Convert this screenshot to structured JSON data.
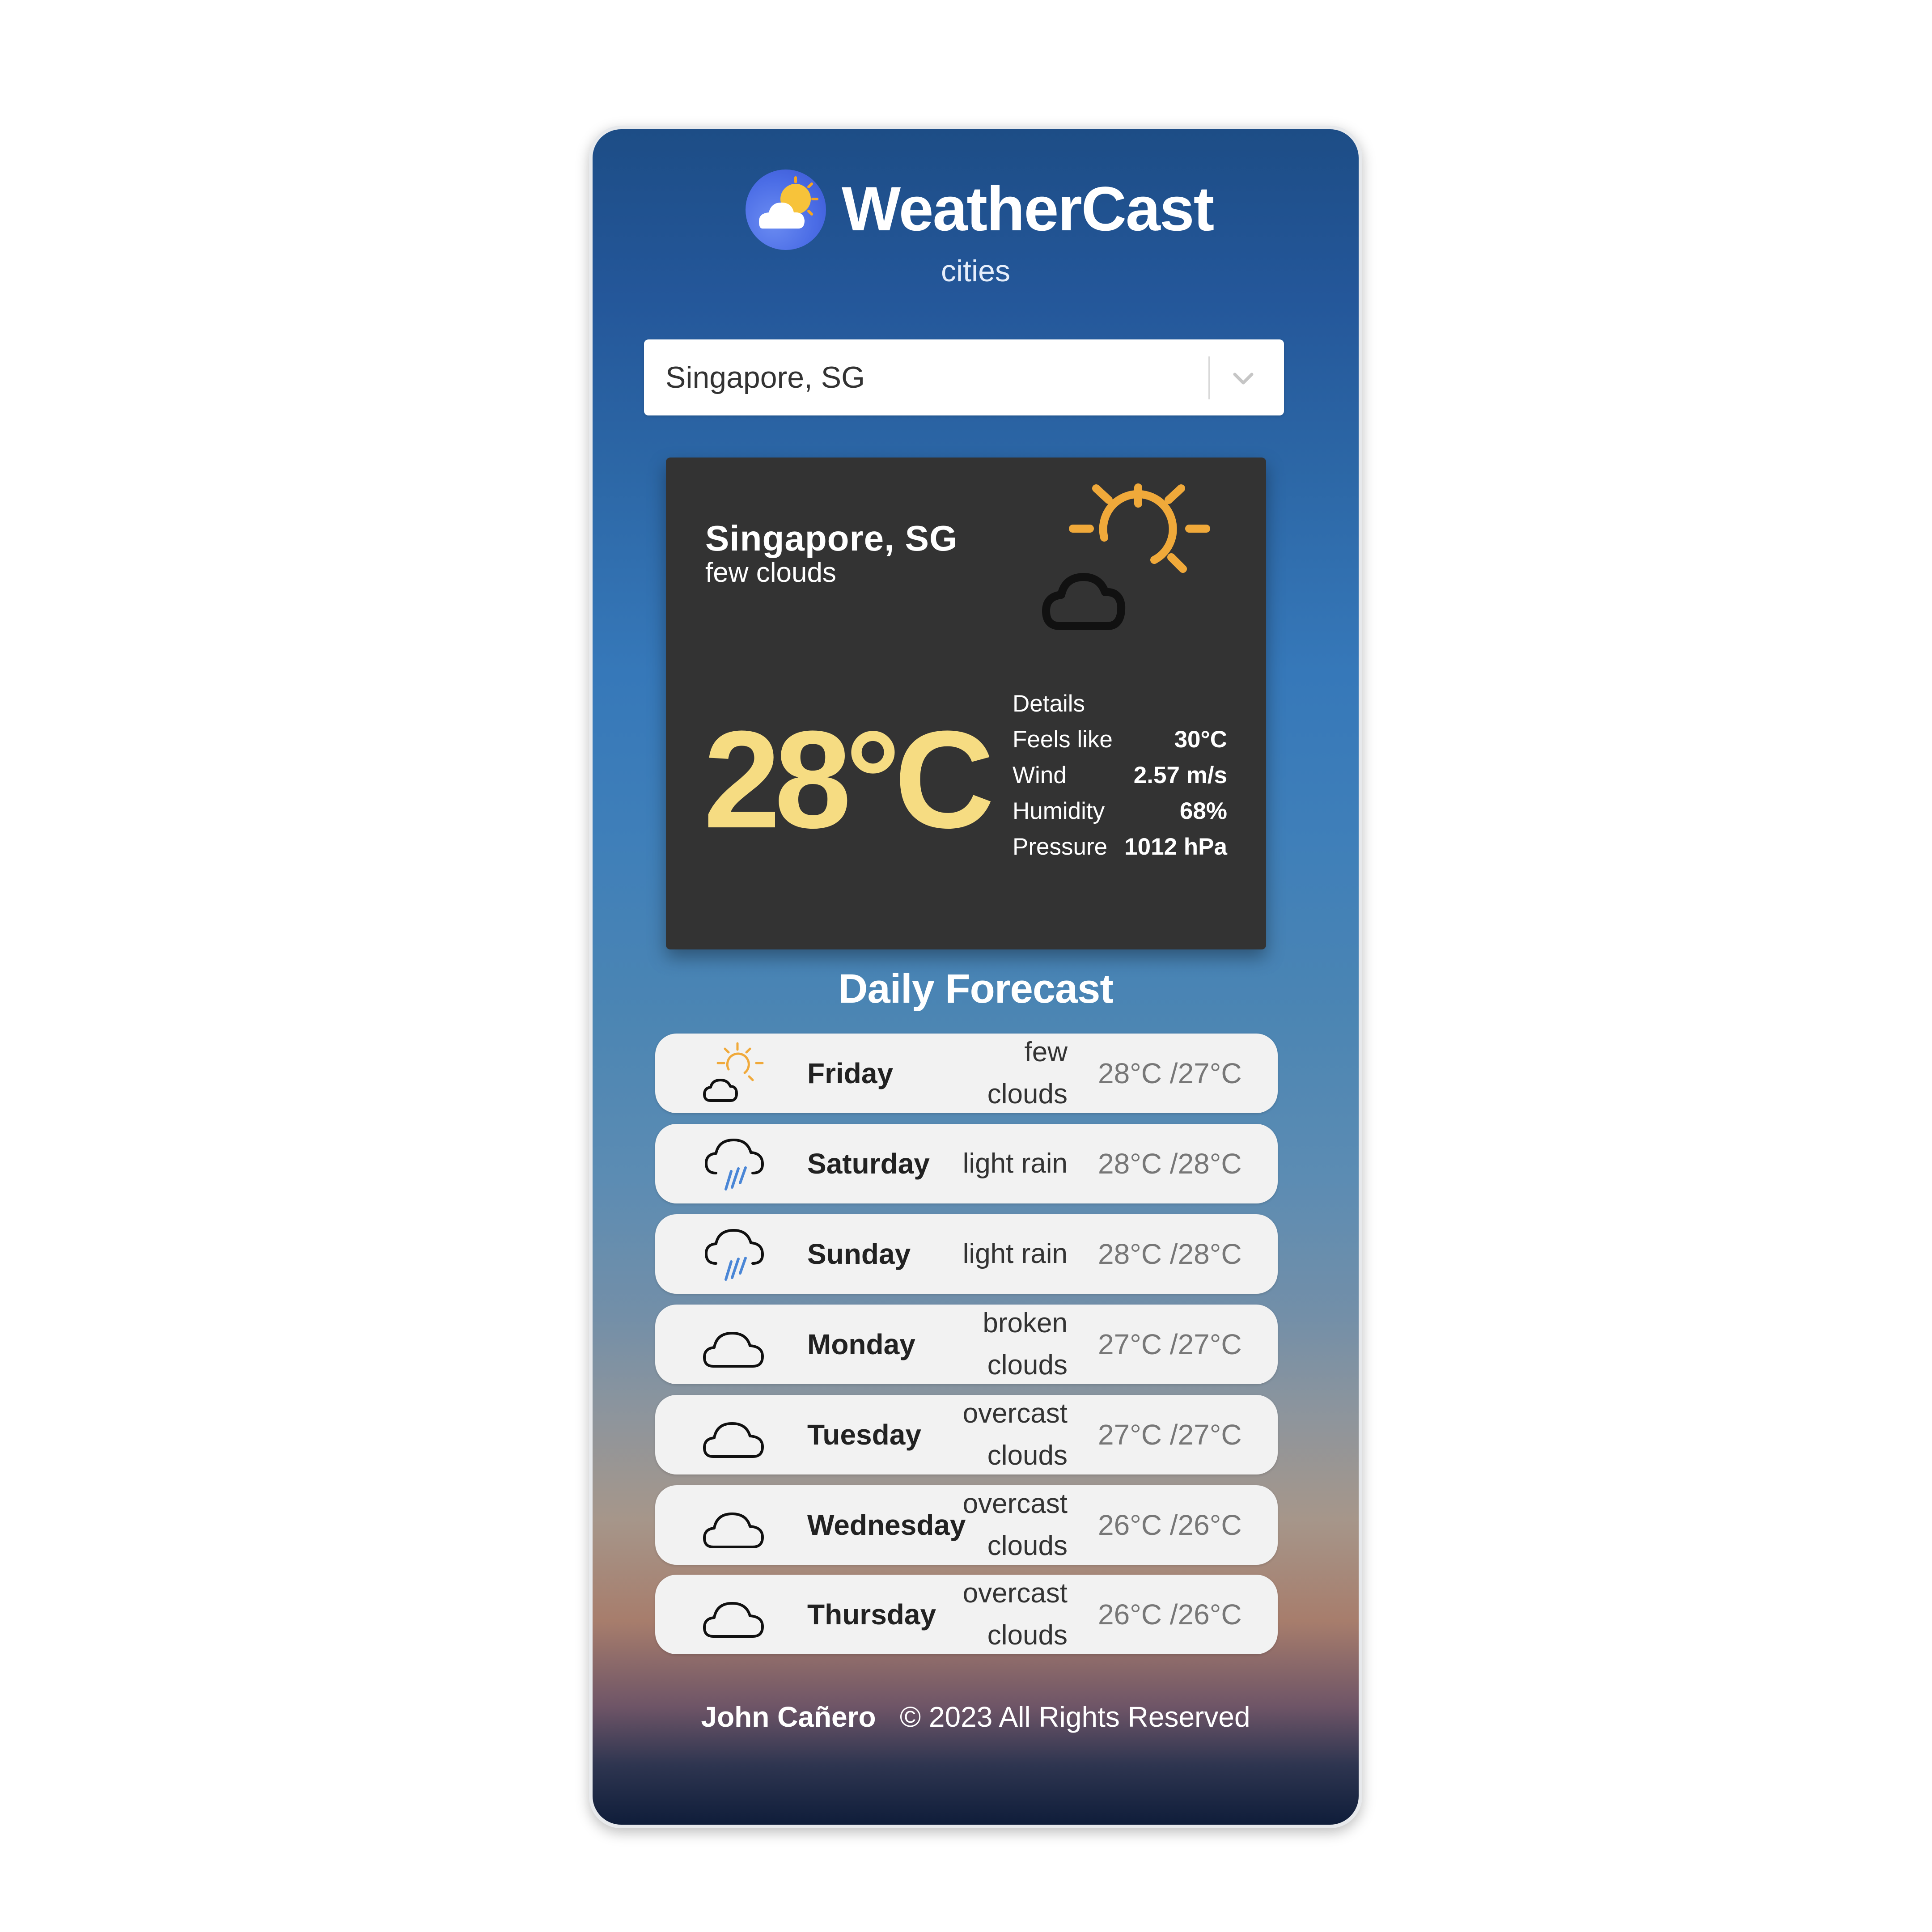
{
  "app": {
    "title": "WeatherCast",
    "subtitle": "cities",
    "logo_icon": "weather-logo-icon"
  },
  "search": {
    "selected": "Singapore, SG",
    "dropdown_icon": "chevron-down-icon"
  },
  "current": {
    "city": "Singapore, SG",
    "description": "few clouds",
    "icon": "sun-behind-cloud-icon",
    "temperature": "28°C",
    "details_label": "Details",
    "details": [
      {
        "label": "Feels like",
        "value": "30°C"
      },
      {
        "label": "Wind",
        "value": "2.57 m/s"
      },
      {
        "label": "Humidity",
        "value": "68%"
      },
      {
        "label": "Pressure",
        "value": "1012 hPa"
      }
    ]
  },
  "forecast": {
    "title": "Daily Forecast",
    "days": [
      {
        "day": "Friday",
        "description": "few clouds",
        "range": "28°C /27°C",
        "icon": "sun-cloud-icon"
      },
      {
        "day": "Saturday",
        "description": "light rain",
        "range": "28°C /28°C",
        "icon": "rain-cloud-icon"
      },
      {
        "day": "Sunday",
        "description": "light rain",
        "range": "28°C /28°C",
        "icon": "rain-cloud-icon"
      },
      {
        "day": "Monday",
        "description": "broken clouds",
        "range": "27°C /27°C",
        "icon": "cloud-icon"
      },
      {
        "day": "Tuesday",
        "description": "overcast clouds",
        "range": "27°C /27°C",
        "icon": "cloud-icon"
      },
      {
        "day": "Wednesday",
        "description": "overcast clouds",
        "range": "26°C /26°C",
        "icon": "cloud-icon"
      },
      {
        "day": "Thursday",
        "description": "overcast clouds",
        "range": "26°C /26°C",
        "icon": "cloud-icon"
      }
    ]
  },
  "footer": {
    "author": "John Cañero",
    "rights": "© 2023 All Rights Reserved"
  },
  "colors": {
    "temperature": "#f6dc82",
    "card": "#333333",
    "sun": "#f0a93a",
    "rain": "#4a86d6"
  }
}
